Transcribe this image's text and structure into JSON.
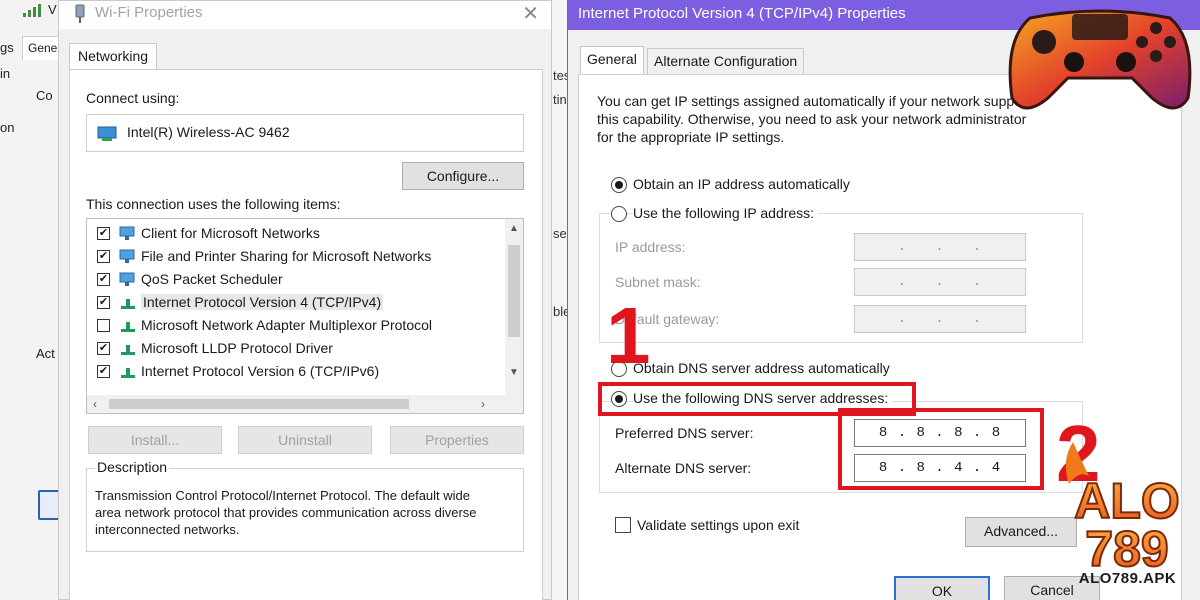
{
  "background_window": {
    "tab_label": "Gene",
    "title_fragment": "V",
    "left_text": [
      "gs",
      "in",
      "Co",
      "on",
      "Act"
    ]
  },
  "mid_strip": {
    "fragments": [
      "tes",
      "tin",
      "se",
      "ble"
    ]
  },
  "wifi_dialog": {
    "title": "Wi-Fi Properties",
    "tab": "Networking",
    "connect_using_label": "Connect using:",
    "adapter_name": "Intel(R) Wireless-AC 9462",
    "configure_button": "Configure...",
    "items_label": "This connection uses the following items:",
    "items": [
      {
        "label": "Client for Microsoft Networks",
        "checked": true
      },
      {
        "label": "File and Printer Sharing for Microsoft Networks",
        "checked": true
      },
      {
        "label": "QoS Packet Scheduler",
        "checked": true
      },
      {
        "label": "Internet Protocol Version 4 (TCP/IPv4)",
        "checked": true,
        "selected": true
      },
      {
        "label": "Microsoft Network Adapter Multiplexor Protocol",
        "checked": false
      },
      {
        "label": "Microsoft LLDP Protocol Driver",
        "checked": true
      },
      {
        "label": "Internet Protocol Version 6 (TCP/IPv6)",
        "checked": true
      }
    ],
    "buttons": {
      "install": "Install...",
      "uninstall": "Uninstall",
      "properties": "Properties"
    },
    "description_legend": "Description",
    "description_text": "Transmission Control Protocol/Internet Protocol. The default wide area network protocol that provides communication across diverse interconnected networks."
  },
  "ipv4_dialog": {
    "title": "Internet Protocol Version 4 (TCP/IPv4) Properties",
    "tabs": [
      "General",
      "Alternate Configuration"
    ],
    "intro_lines": [
      "You can get IP settings assigned automatically if your network supports",
      "this capability. Otherwise, you need to ask your network administrator",
      "for the appropriate IP settings."
    ],
    "ip_auto_label": "Obtain an IP address automatically",
    "ip_manual_label": "Use the following IP address:",
    "ip_auto_selected": true,
    "ip_address_label": "IP address:",
    "subnet_mask_label": "Subnet mask:",
    "default_gateway_label": "Default gateway:",
    "empty_ip": " .   .   . ",
    "dns_auto_label": "Obtain DNS server address automatically",
    "dns_manual_label": "Use the following DNS server addresses:",
    "dns_manual_selected": true,
    "preferred_dns_label": "Preferred DNS server:",
    "preferred_dns_value": "8 . 8 . 8 . 8",
    "alternate_dns_label": "Alternate DNS server:",
    "alternate_dns_value": "8 . 8 . 4 . 4",
    "validate_label": "Validate settings upon exit",
    "advanced_button": "Advanced...",
    "ok_button": "OK",
    "cancel_button": "Cancel"
  },
  "annotations": {
    "step1": "1",
    "step2": "2",
    "color": "#e0161e"
  },
  "brand": {
    "logo_line1": "ALO",
    "logo_line2": "789",
    "site": "ALO789.APK"
  },
  "colors": {
    "ipv4_titlebar": "#7b5fe0",
    "annotation_red": "#e0161e"
  }
}
